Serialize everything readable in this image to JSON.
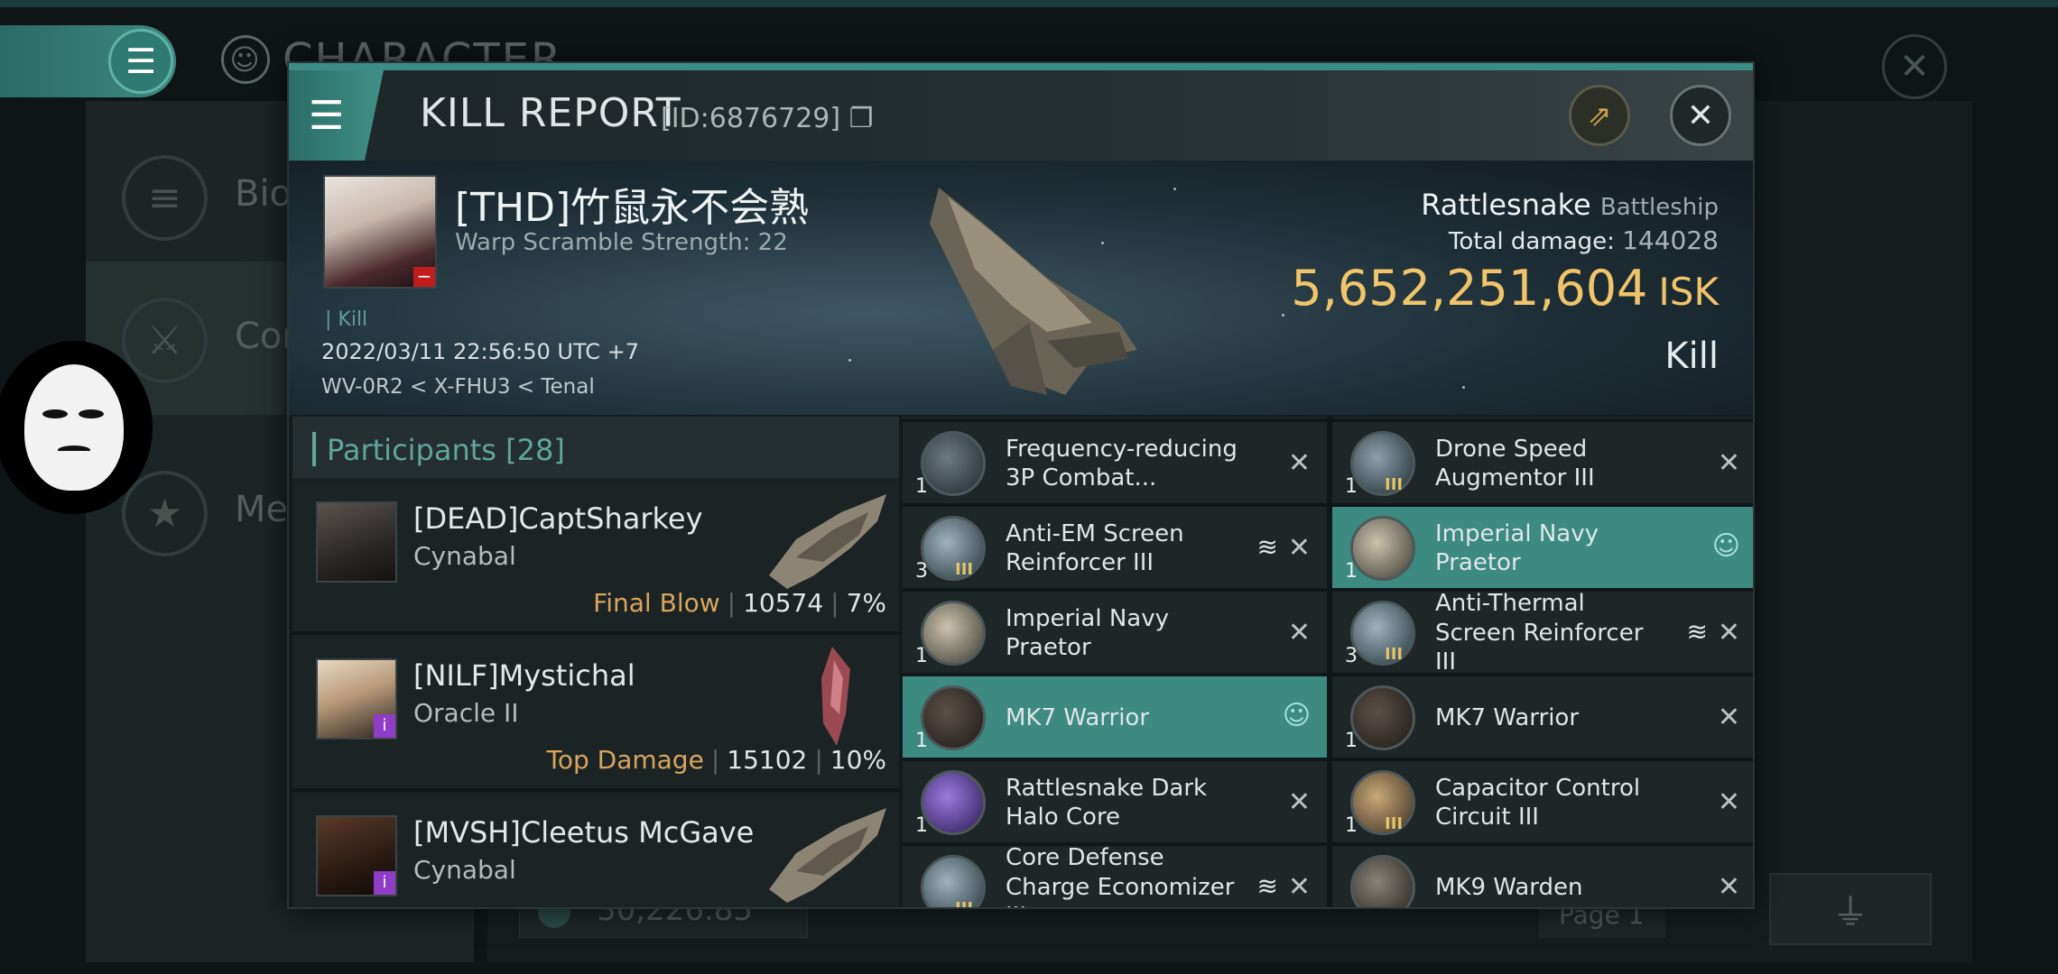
{
  "background": {
    "title": "CHARACTER",
    "sidebar": [
      {
        "label": "Bio",
        "icon": "list-icon"
      },
      {
        "label": "Cor",
        "icon": "crossed-swords-icon"
      },
      {
        "label": "Med",
        "icon": "star-icon"
      }
    ],
    "bottom_value": "30,226.85",
    "page_label": "Page 1"
  },
  "kill_report": {
    "title": "KILL REPORT",
    "id_text": "[ID:6876729]",
    "victim": {
      "name": "[THD]竹鼠永不会熟",
      "warp": "Warp Scramble Strength: 22",
      "kill_tag": "Kill",
      "date": "2022/03/11 22:56:50 UTC +7",
      "location": "WV-0R2 < X-FHU3 < Tenal"
    },
    "ship": {
      "name": "Rattlesnake",
      "class": "Battleship",
      "total_damage_label": "Total damage:",
      "total_damage": "144028",
      "isk_value": "5,652,251,604",
      "isk_unit": "ISK",
      "result": "Kill"
    },
    "participants": {
      "header": "Participants",
      "count": "[28]",
      "rows": [
        {
          "name": "[DEAD]CaptSharkey",
          "ship": "Cynabal",
          "badge": "Final Blow",
          "damage": "10574",
          "pct": "7%"
        },
        {
          "name": "[NILF]Mystichal",
          "ship": "Oracle II",
          "badge": "Top Damage",
          "damage": "15102",
          "pct": "10%"
        },
        {
          "name": "[MVSH]Cleetus McGave",
          "ship": "Cynabal",
          "badge": "",
          "damage": "",
          "pct": ""
        }
      ]
    },
    "items": [
      {
        "name": "Frequency-reducing 3P Combat...",
        "qty": "1",
        "meta": "",
        "highlight": false,
        "stack": false,
        "user": false
      },
      {
        "name": "Drone Speed Augmentor III",
        "qty": "1",
        "meta": "III",
        "highlight": false,
        "stack": false,
        "user": false
      },
      {
        "name": "Anti-EM Screen Reinforcer III",
        "qty": "3",
        "meta": "III",
        "highlight": false,
        "stack": true,
        "user": false
      },
      {
        "name": "Imperial Navy Praetor",
        "qty": "1",
        "meta": "",
        "highlight": true,
        "stack": false,
        "user": true
      },
      {
        "name": "Imperial Navy Praetor",
        "qty": "1",
        "meta": "",
        "highlight": false,
        "stack": false,
        "user": false
      },
      {
        "name": "Anti-Thermal Screen Reinforcer III",
        "qty": "3",
        "meta": "III",
        "highlight": false,
        "stack": true,
        "user": false
      },
      {
        "name": "MK7 Warrior",
        "qty": "1",
        "meta": "",
        "highlight": true,
        "stack": false,
        "user": true
      },
      {
        "name": "MK7 Warrior",
        "qty": "1",
        "meta": "",
        "highlight": false,
        "stack": false,
        "user": false
      },
      {
        "name": "Rattlesnake Dark Halo Core",
        "qty": "1",
        "meta": "",
        "highlight": false,
        "stack": false,
        "user": false
      },
      {
        "name": "Capacitor Control Circuit III",
        "qty": "1",
        "meta": "III",
        "highlight": false,
        "stack": false,
        "user": false
      },
      {
        "name": "Core Defense Charge Economizer III",
        "qty": "",
        "meta": "III",
        "highlight": false,
        "stack": true,
        "user": false
      },
      {
        "name": "MK9 Warden",
        "qty": "",
        "meta": "",
        "highlight": false,
        "stack": false,
        "user": false
      }
    ]
  },
  "colors": {
    "accent": "#3c8a80",
    "isk": "#f0c46a",
    "badge": "#d8a55c"
  }
}
